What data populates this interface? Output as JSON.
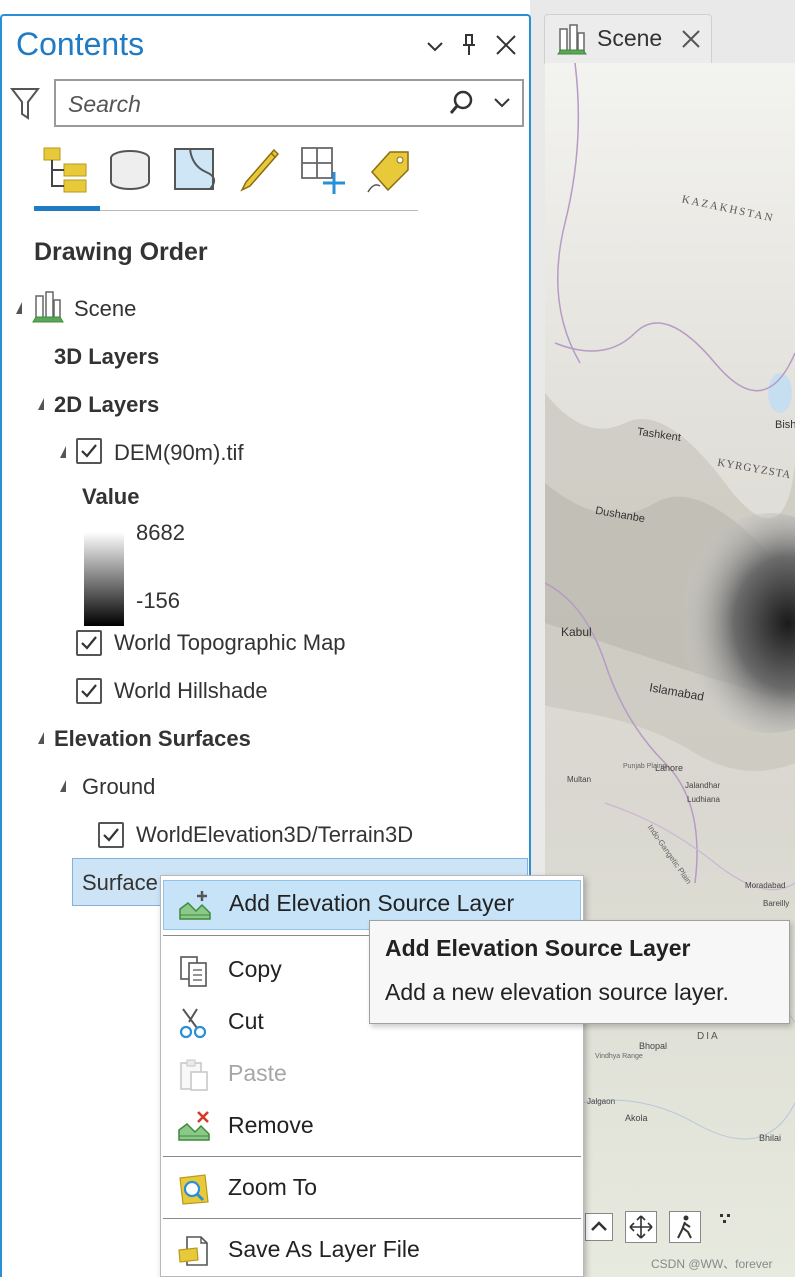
{
  "pane": {
    "title": "Contents",
    "search_placeholder": "Search",
    "section_title": "Drawing Order"
  },
  "map_tab": {
    "label": "Scene"
  },
  "tree": {
    "scene": "Scene",
    "layers_3d": "3D Layers",
    "layers_2d": "2D Layers",
    "dem": "DEM(90m).tif",
    "legend_title": "Value",
    "legend_max": "8682",
    "legend_min": "-156",
    "world_topo": "World Topographic Map",
    "world_hillshade": "World Hillshade",
    "elevation_surfaces": "Elevation Surfaces",
    "ground": "Ground",
    "world_elevation": "WorldElevation3D/Terrain3D",
    "surface": "Surface"
  },
  "context_menu": {
    "items": [
      {
        "label": "Add Elevation Source Layer",
        "icon": "add-elevation-icon",
        "enabled": true
      },
      {
        "label": "Copy",
        "icon": "copy-icon",
        "enabled": true
      },
      {
        "label": "Cut",
        "icon": "cut-icon",
        "enabled": true
      },
      {
        "label": "Paste",
        "icon": "paste-icon",
        "enabled": false
      },
      {
        "label": "Remove",
        "icon": "remove-elevation-icon",
        "enabled": true
      },
      {
        "label": "Zoom To",
        "icon": "zoom-to-icon",
        "enabled": true
      },
      {
        "label": "Save As Layer File",
        "icon": "save-layer-file-icon",
        "enabled": true
      }
    ]
  },
  "tooltip": {
    "title": "Add Elevation Source Layer",
    "description": "Add a new elevation source layer."
  },
  "map_labels": {
    "kazakhstan": "KAZAKHSTAN",
    "tashkent": "Tashkent",
    "kyrgyzstan": "KYRGYZSTA",
    "bish": "Bish",
    "dushanbe": "Dushanbe",
    "kabul": "Kabul",
    "islamabad": "Islamabad",
    "lahore": "Lahore",
    "jalandhar": "Jalandhar",
    "ludhiana": "Ludhiana",
    "multan": "Multan",
    "punjab": "Punjab Plains",
    "indo_gangetic": "Indo-Gangetic Plain",
    "moradabad": "Moradabad",
    "bareilly": "Bareilly",
    "bhopal": "Bhopal",
    "vindhya": "Vindhya Range",
    "jalgaon": "Jalgaon",
    "akola": "Akola",
    "bhilai": "Bhilai",
    "dia": "DIA",
    "watermark": "CSDN @WW、forever"
  },
  "colors": {
    "accent": "#2b8fd6",
    "selection": "#cde4f7",
    "menu_highlight": "#c7e3f8"
  }
}
